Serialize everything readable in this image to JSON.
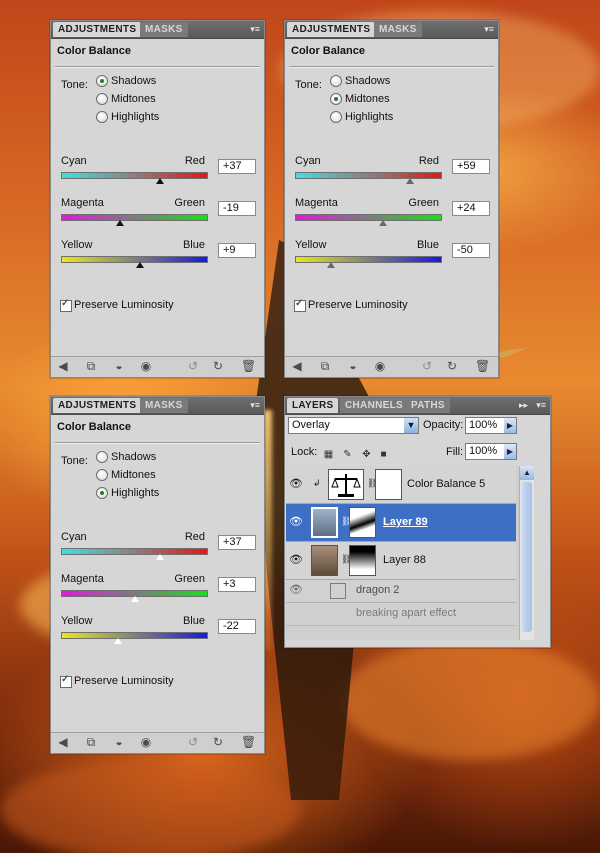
{
  "adjustments_panels": [
    {
      "tabs": [
        "ADJUSTMENTS",
        "MASKS"
      ],
      "title": "Color Balance",
      "tone_label": "Tone:",
      "tones": [
        "Shadows",
        "Midtones",
        "Highlights"
      ],
      "selected_tone": "Shadows",
      "sliders": [
        {
          "left": "Cyan",
          "right": "Red",
          "value": "+37",
          "fraction": 0.68
        },
        {
          "left": "Magenta",
          "right": "Green",
          "value": "-19",
          "fraction": 0.41
        },
        {
          "left": "Yellow",
          "right": "Blue",
          "value": "+9",
          "fraction": 0.545
        }
      ],
      "preserve_label": "Preserve Luminosity",
      "preserve_checked": true
    },
    {
      "tabs": [
        "ADJUSTMENTS",
        "MASKS"
      ],
      "title": "Color Balance",
      "tone_label": "Tone:",
      "tones": [
        "Shadows",
        "Midtones",
        "Highlights"
      ],
      "selected_tone": "Midtones",
      "sliders": [
        {
          "left": "Cyan",
          "right": "Red",
          "value": "+59",
          "fraction": 0.79
        },
        {
          "left": "Magenta",
          "right": "Green",
          "value": "+24",
          "fraction": 0.61
        },
        {
          "left": "Yellow",
          "right": "Blue",
          "value": "-50",
          "fraction": 0.25
        }
      ],
      "preserve_label": "Preserve Luminosity",
      "preserve_checked": true
    },
    {
      "tabs": [
        "ADJUSTMENTS",
        "MASKS"
      ],
      "title": "Color Balance",
      "tone_label": "Tone:",
      "tones": [
        "Shadows",
        "Midtones",
        "Highlights"
      ],
      "selected_tone": "Highlights",
      "sliders": [
        {
          "left": "Cyan",
          "right": "Red",
          "value": "+37",
          "fraction": 0.68
        },
        {
          "left": "Magenta",
          "right": "Green",
          "value": "+3",
          "fraction": 0.51
        },
        {
          "left": "Yellow",
          "right": "Blue",
          "value": "-22",
          "fraction": 0.39
        }
      ],
      "preserve_label": "Preserve Luminosity",
      "preserve_checked": true
    }
  ],
  "layers_panel": {
    "tabs": [
      "LAYERS",
      "CHANNELS",
      "PATHS"
    ],
    "blend_mode": "Overlay",
    "opacity_label": "Opacity:",
    "opacity": "100%",
    "lock_label": "Lock:",
    "fill_label": "Fill:",
    "fill": "100%",
    "layers": [
      {
        "name": "Color Balance 5",
        "selected": false
      },
      {
        "name": "Layer 89",
        "selected": true
      },
      {
        "name": "Layer 88",
        "selected": false
      },
      {
        "name": "dragon 2",
        "selected": false
      },
      {
        "name": "breaking apart effect",
        "selected": false
      }
    ]
  },
  "colors": {
    "panel_bg": "#d6d6d6",
    "selected_layer": "#3d6fc4",
    "radio_selected": "#2b7a2b"
  }
}
